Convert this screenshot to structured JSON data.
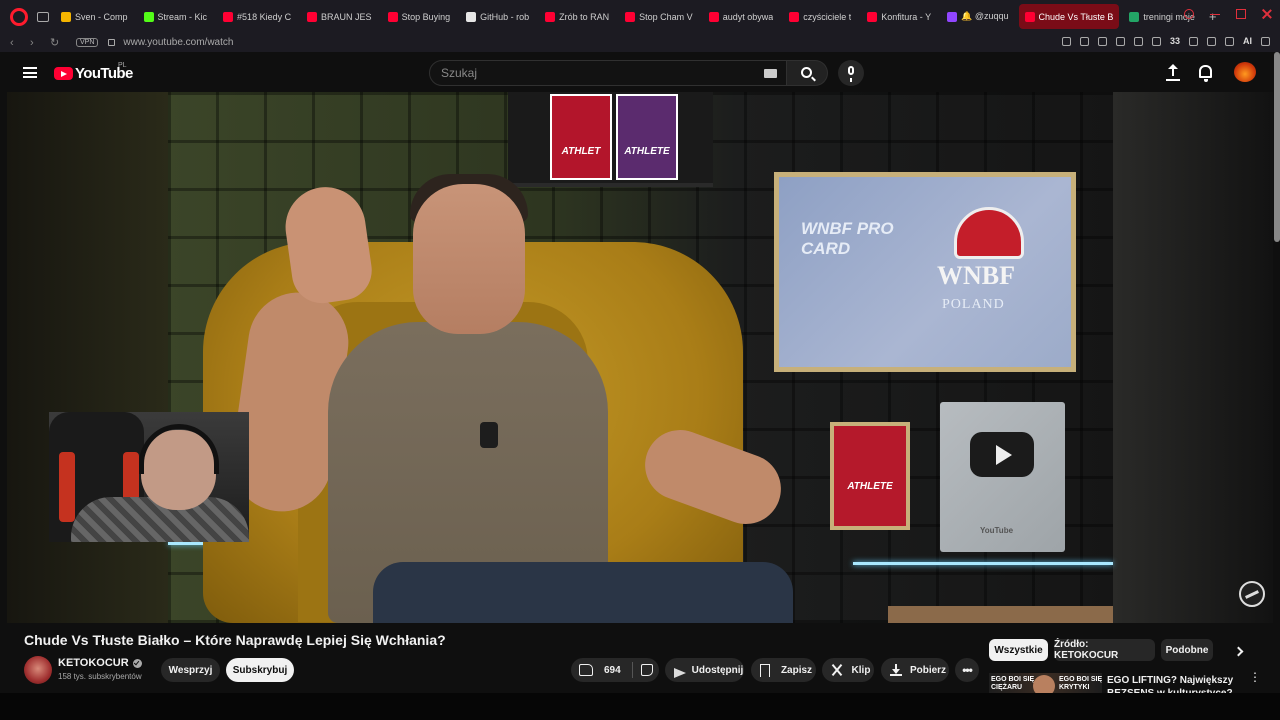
{
  "browser": {
    "tabs": [
      {
        "label": "Sven - Comp",
        "color": "#f4b400"
      },
      {
        "label": "Stream - Kic",
        "color": "#53fc18"
      },
      {
        "label": "#518 Kiedy C",
        "color": "#ff0033"
      },
      {
        "label": "BRAUN JES",
        "color": "#ff0033"
      },
      {
        "label": "Stop Buying",
        "color": "#ff0033"
      },
      {
        "label": "GitHub - rob",
        "color": "#e6e6e6"
      },
      {
        "label": "Zrób to RAN",
        "color": "#ff0033"
      },
      {
        "label": "Stop Cham V",
        "color": "#ff0033"
      },
      {
        "label": "audyt obywa",
        "color": "#ff0033"
      },
      {
        "label": "czyściciele t",
        "color": "#ff0033"
      },
      {
        "label": "Konfitura - Y",
        "color": "#ff0033"
      },
      {
        "label": "🔔 @zuqqu",
        "color": "#9146ff"
      },
      {
        "label": "Chude Vs Tłuste B",
        "color": "#ff0033",
        "active": true
      },
      {
        "label": "treningi moje",
        "color": "#23a566"
      }
    ],
    "new_tab": "+",
    "vpn_label": "VPN",
    "url": "www.youtube.com/watch",
    "ai_label": "AI",
    "ext_badge": "33"
  },
  "youtube": {
    "logo_text": "YouTube",
    "region": "PL",
    "search_placeholder": "Szukaj"
  },
  "video": {
    "shelf_award_1": "ATHLET",
    "shelf_award_2": "ATHLETE",
    "pro_card": "WNBF PRO CARD",
    "wnbf": "WNBF",
    "poland": "POLAND",
    "plaque": "ATHLETE",
    "silver_button": "YouTube"
  },
  "meta": {
    "title": "Chude Vs Tłuste Białko – Które Naprawdę Lepiej Się Wchłania?",
    "channel_name": "KETOKOCUR",
    "subscribers": "158 tys. subskrybentów",
    "support_label": "Wesprzyj",
    "subscribe_label": "Subskrybuj",
    "likes": "694",
    "share_label": "Udostępnij",
    "save_label": "Zapisz",
    "clip_label": "Klip",
    "download_label": "Pobierz",
    "more_label": "•••"
  },
  "sidebar": {
    "chips": [
      "Wszystkie",
      "Źródło: KETOKOCUR",
      "Podobne"
    ],
    "reco_thumb_left": "EGO BOI SIĘ CIĘŻARU",
    "reco_thumb_right": "EGO BOI SIĘ KRYTYKI",
    "reco_title": "EGO LIFTING? Największy BEZSENS w kulturystyce? Pas"
  }
}
